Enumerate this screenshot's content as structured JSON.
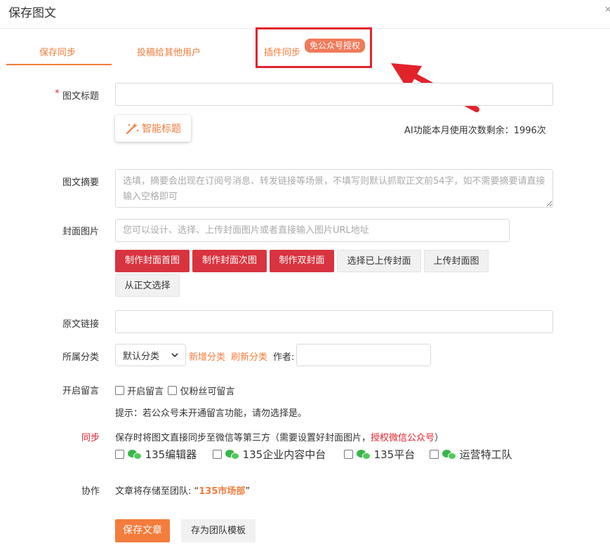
{
  "dialog": {
    "title": "保存图文",
    "close": "×"
  },
  "tabs": [
    {
      "label": "保存同步"
    },
    {
      "label": "投稿给其他用户"
    },
    {
      "label": "插件同步",
      "badge": "免公众号授权"
    }
  ],
  "form": {
    "title_label": "图文标题",
    "required_mark": "*",
    "title_value": "",
    "ai_button": "智能标题",
    "ai_note": "AI功能本月使用次数剩余：1996次",
    "summary_label": "图文摘要",
    "summary_placeholder": "选填，摘要会出现在订阅号消息、转发链接等场景，不填写则默认抓取正文前54字，如不需要摘要请直接输入空格即可",
    "cover_label": "封面图片",
    "cover_placeholder": "您可以设计、选择、上传封面图片或者直接输入图片URL地址",
    "cover_buttons": [
      "制作封面首图",
      "制作封面次图",
      "制作双封面",
      "选择已上传封面",
      "上传封面图",
      "从正文选择"
    ],
    "source_label": "原文链接",
    "category_label": "所属分类",
    "category_value": "默认分类",
    "new_category": "新增分类",
    "refresh_category": "刷新分类",
    "author_label": "作者:",
    "comment_label": "开启留言",
    "comment_opt1": "开启留言",
    "comment_opt2": "仅粉丝可留言",
    "comment_tip": "提示：若公众号未开通留言功能，请勿选择是。",
    "sync_label": "同步",
    "sync_desc_pre": "保存时将图文直接同步至微信等第三方（需要设置好封面图片，",
    "sync_desc_link": "授权微信公众号",
    "sync_desc_post": "）",
    "sync_targets": [
      "135编辑器",
      "135企业内容中台",
      "135平台",
      "运营特工队"
    ],
    "collab_label": "协作",
    "collab_pre": "文章将存储至团队: “",
    "collab_team": "135市场部",
    "collab_post": "”",
    "save_button": "保存文章",
    "template_button": "存为团队模板"
  },
  "colors": {
    "accent": "#f47c3c",
    "danger": "#d8343f",
    "highlight": "#e3232c"
  }
}
